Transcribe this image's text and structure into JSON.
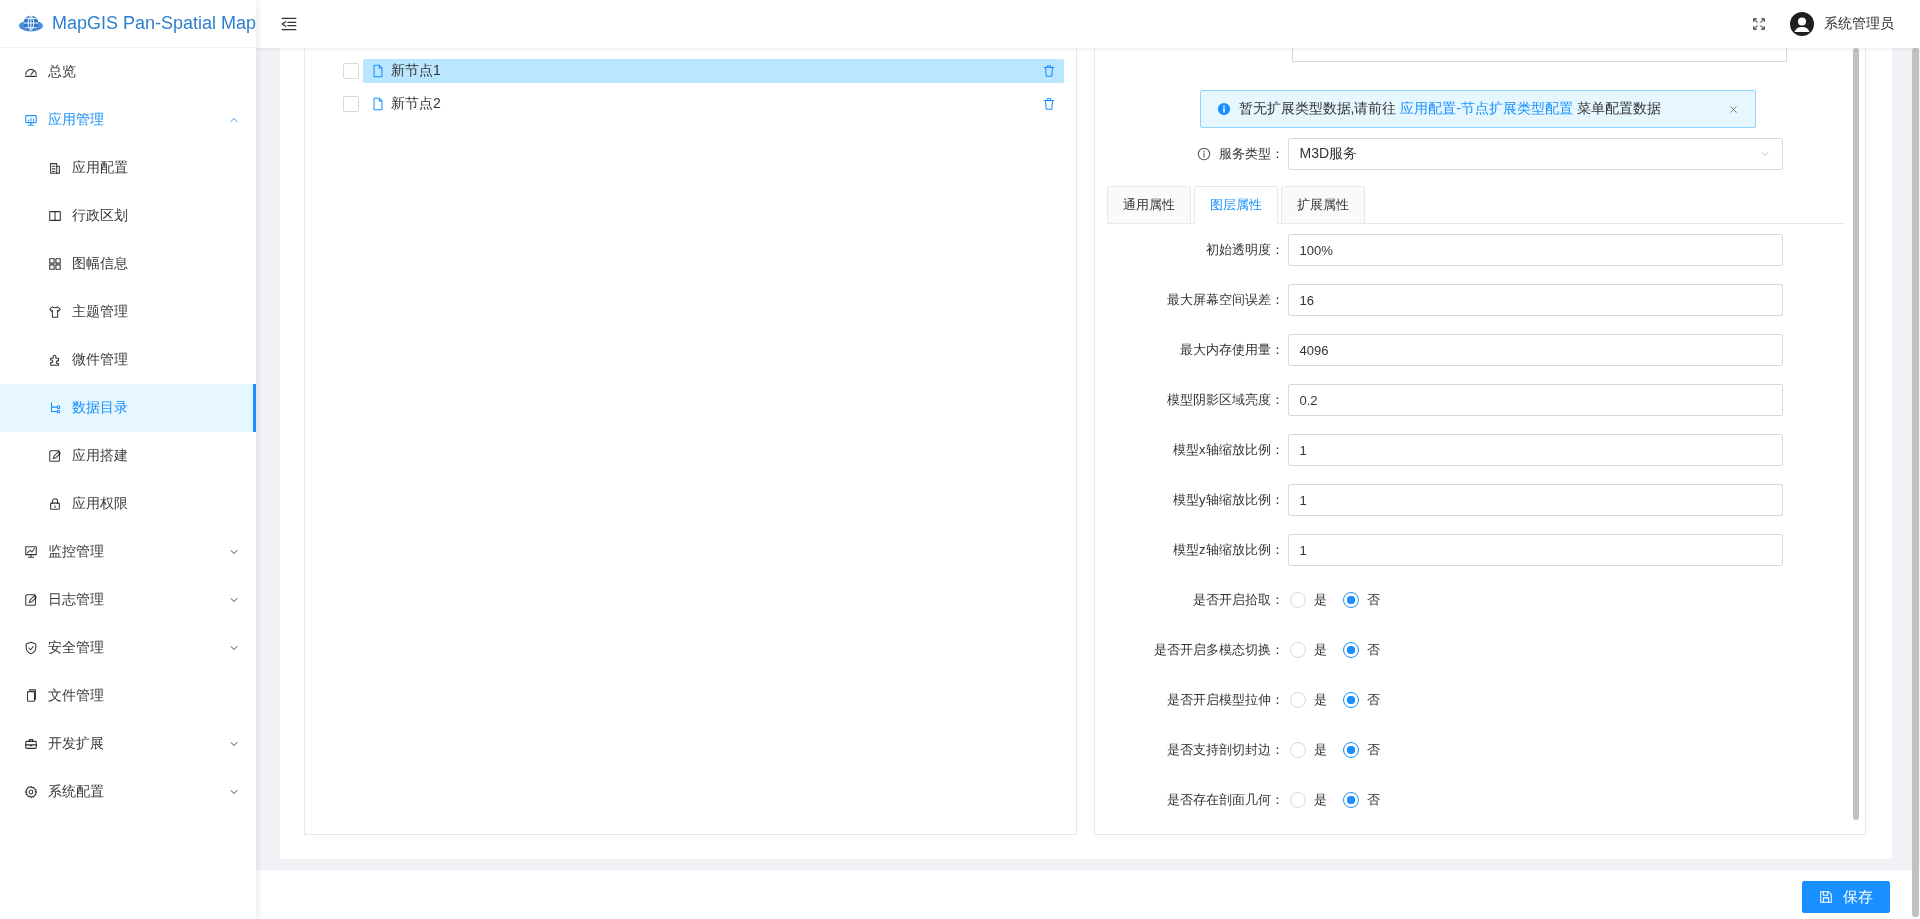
{
  "app": {
    "title": "MapGIS Pan-Spatial Map"
  },
  "header": {
    "user": "系统管理员"
  },
  "sidebar": {
    "items": [
      {
        "label": "总览",
        "selected": false
      },
      {
        "label": "应用管理",
        "selected": false,
        "expanded": true,
        "children": [
          {
            "label": "应用配置",
            "selected": false
          },
          {
            "label": "行政区划",
            "selected": false
          },
          {
            "label": "图幅信息",
            "selected": false
          },
          {
            "label": "主题管理",
            "selected": false
          },
          {
            "label": "微件管理",
            "selected": false
          },
          {
            "label": "数据目录",
            "selected": true
          },
          {
            "label": "应用搭建",
            "selected": false
          },
          {
            "label": "应用权限",
            "selected": false
          }
        ]
      },
      {
        "label": "监控管理",
        "selected": false,
        "expanded": false
      },
      {
        "label": "日志管理",
        "selected": false,
        "expanded": false
      },
      {
        "label": "安全管理",
        "selected": false,
        "expanded": false
      },
      {
        "label": "文件管理",
        "selected": false
      },
      {
        "label": "开发扩展",
        "selected": false,
        "expanded": false
      },
      {
        "label": "系统配置",
        "selected": false,
        "expanded": false
      }
    ]
  },
  "tree": {
    "nodes": [
      {
        "label": "新节点1",
        "selected": true,
        "checked": false
      },
      {
        "label": "新节点2",
        "selected": false,
        "checked": false
      }
    ]
  },
  "alert": {
    "text_before": "暂无扩展类型数据,请前往 ",
    "link": "应用配置-节点扩展类型配置",
    "text_after": " 菜单配置数据"
  },
  "service_type": {
    "label": "服务类型：",
    "value": "M3D服务"
  },
  "tabs": [
    {
      "label": "通用属性",
      "selected": false
    },
    {
      "label": "图层属性",
      "selected": true
    },
    {
      "label": "扩展属性",
      "selected": false
    }
  ],
  "fields": [
    {
      "kind": "input",
      "label": "初始透明度：",
      "value": "100%"
    },
    {
      "kind": "input",
      "label": "最大屏幕空间误差：",
      "value": "16"
    },
    {
      "kind": "input",
      "label": "最大内存使用量：",
      "value": "4096"
    },
    {
      "kind": "input",
      "label": "模型阴影区域亮度：",
      "value": "0.2"
    },
    {
      "kind": "input",
      "label": "模型x轴缩放比例：",
      "value": "1"
    },
    {
      "kind": "input",
      "label": "模型y轴缩放比例：",
      "value": "1"
    },
    {
      "kind": "input",
      "label": "模型z轴缩放比例：",
      "value": "1"
    },
    {
      "kind": "radio",
      "label": "是否开启拾取：",
      "options": [
        {
          "label": "是",
          "selected": false
        },
        {
          "label": "否",
          "selected": true
        }
      ]
    },
    {
      "kind": "radio",
      "label": "是否开启多模态切换：",
      "options": [
        {
          "label": "是",
          "selected": false
        },
        {
          "label": "否",
          "selected": true
        }
      ]
    },
    {
      "kind": "radio",
      "label": "是否开启模型拉伸：",
      "options": [
        {
          "label": "是",
          "selected": false
        },
        {
          "label": "否",
          "selected": true
        }
      ]
    },
    {
      "kind": "radio",
      "label": "是否支持剖切封边：",
      "options": [
        {
          "label": "是",
          "selected": false
        },
        {
          "label": "否",
          "selected": true
        }
      ]
    },
    {
      "kind": "radio",
      "label": "是否存在剖面几何：",
      "options": [
        {
          "label": "是",
          "selected": false
        },
        {
          "label": "否",
          "selected": true
        }
      ]
    }
  ],
  "footer": {
    "save": "保存"
  }
}
